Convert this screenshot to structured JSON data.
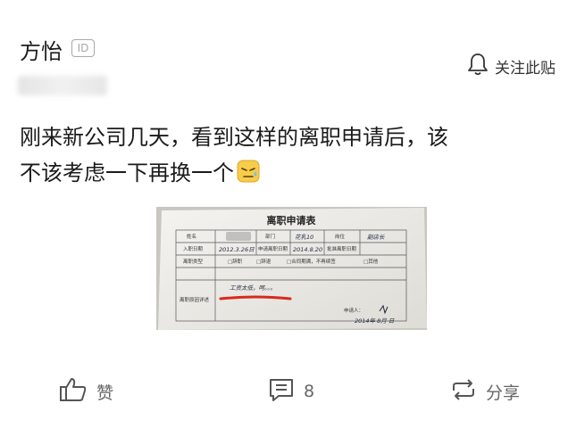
{
  "author": {
    "name": "方怡",
    "id_badge": "ID"
  },
  "follow": {
    "label": "关注此贴",
    "icon": "bell-icon"
  },
  "post": {
    "text_line1": "刚来新公司几天，看到这样的离职申请后，该",
    "text_line2": "不该考虑一下再换一个",
    "emoji": "sweat-face-emoji"
  },
  "photo": {
    "form_title": "离职申请表",
    "row1": {
      "name_label": "姓名",
      "dept_label": "部门",
      "dept_value": "花乳10",
      "position_label": "岗位",
      "position_value": "副店长"
    },
    "row2": {
      "join_label": "入职日期",
      "join_value": "2012.3.26日",
      "apply_label": "申请离职日期",
      "apply_value": "2014.8.20",
      "date_label": "批准离职日期"
    },
    "row3": {
      "type_label": "离职类型",
      "options": [
        "□辞职",
        "□辞退",
        "□合同期满，不再续签",
        "□其他"
      ]
    },
    "row4": {
      "reason_label": "离职原因详述",
      "reason_value": "工资太低，呵。。。"
    },
    "footer": {
      "applicant_label": "申请人：",
      "date_value": "2014年 8月 日"
    }
  },
  "actions": {
    "like": {
      "label": "赞",
      "icon": "thumbs-up-icon"
    },
    "comment": {
      "label": "8",
      "icon": "comment-icon"
    },
    "share": {
      "label": "分享",
      "icon": "share-icon"
    }
  },
  "colors": {
    "text": "#222222",
    "muted": "#666666",
    "icon_stroke": "#555555",
    "underline": "#d82a1e"
  }
}
